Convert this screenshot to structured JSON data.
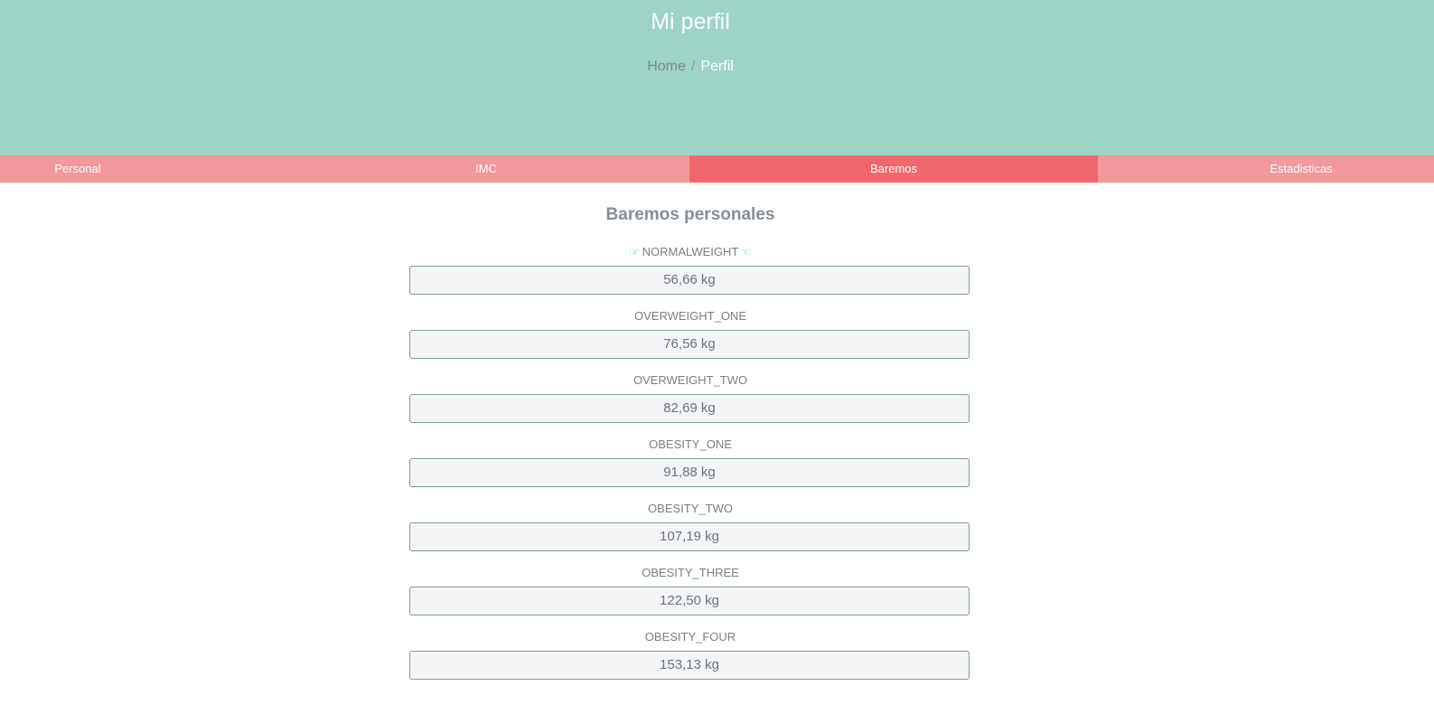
{
  "header": {
    "title": "Mi perfil",
    "breadcrumb": {
      "home": "Home",
      "separator": "/",
      "current": "Perfil"
    },
    "background": "#9dd4c6"
  },
  "tabs": [
    {
      "label": "Personal",
      "active": false
    },
    {
      "label": "IMC",
      "active": false
    },
    {
      "label": "Baremos",
      "active": true
    },
    {
      "label": "Estadisticas",
      "active": false
    }
  ],
  "tab_colors": {
    "inactive": "#f3989b",
    "active": "#f0686d"
  },
  "main": {
    "title": "Baremos personales",
    "highlight_icon": "pointing-hand-icon",
    "baremos": [
      {
        "label": "NORMALWEIGHT",
        "value": "56,66 kg",
        "highlighted": true
      },
      {
        "label": "OVERWEIGHT_ONE",
        "value": "76,56 kg",
        "highlighted": false
      },
      {
        "label": "OVERWEIGHT_TWO",
        "value": "82,69 kg",
        "highlighted": false
      },
      {
        "label": "OBESITY_ONE",
        "value": "91,88 kg",
        "highlighted": false
      },
      {
        "label": "OBESITY_TWO",
        "value": "107,19 kg",
        "highlighted": false
      },
      {
        "label": "OBESITY_THREE",
        "value": "122,50 kg",
        "highlighted": false
      },
      {
        "label": "OBESITY_FOUR",
        "value": "153,13 kg",
        "highlighted": false
      }
    ]
  }
}
